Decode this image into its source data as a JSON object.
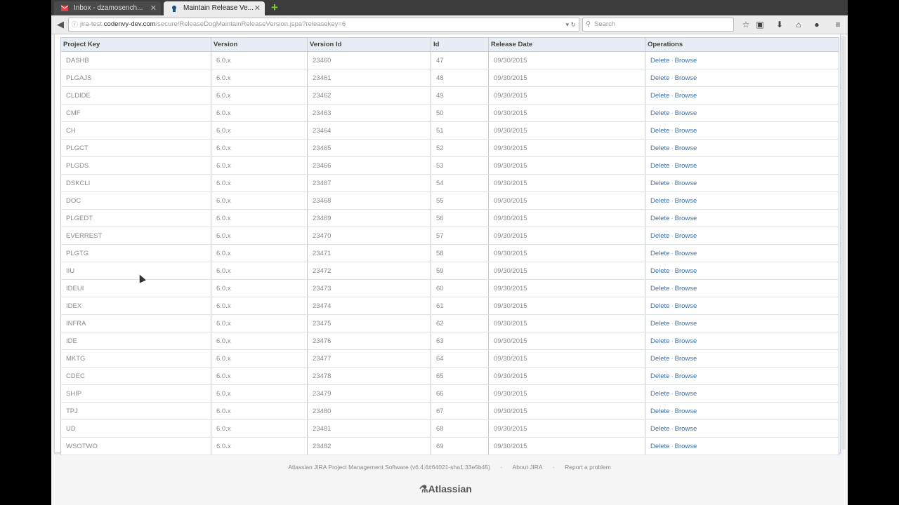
{
  "tabs": [
    {
      "label": "Inbox - dzamosench...",
      "active": false
    },
    {
      "label": "Maintain Release Ve...",
      "active": true
    }
  ],
  "url": {
    "prefix": "jira-test.",
    "domain": "codenvy-dev.com",
    "path": "/secure/ReleaseDogMaintainReleaseVersion.jspa?releasekey=6"
  },
  "search_placeholder": "Search",
  "columns": [
    "Project Key",
    "Version",
    "Version Id",
    "Id",
    "Release Date",
    "Operations"
  ],
  "rows": [
    {
      "key": "DASHB",
      "version": "6.0.x",
      "version_id": "23460",
      "id": "47",
      "date": "09/30/2015"
    },
    {
      "key": "PLGAJS",
      "version": "6.0.x",
      "version_id": "23461",
      "id": "48",
      "date": "09/30/2015"
    },
    {
      "key": "CLDIDE",
      "version": "6.0.x",
      "version_id": "23462",
      "id": "49",
      "date": "09/30/2015"
    },
    {
      "key": "CMF",
      "version": "6.0.x",
      "version_id": "23463",
      "id": "50",
      "date": "09/30/2015"
    },
    {
      "key": "CH",
      "version": "6.0.x",
      "version_id": "23464",
      "id": "51",
      "date": "09/30/2015"
    },
    {
      "key": "PLGCT",
      "version": "6.0.x",
      "version_id": "23465",
      "id": "52",
      "date": "09/30/2015"
    },
    {
      "key": "PLGDS",
      "version": "6.0.x",
      "version_id": "23466",
      "id": "53",
      "date": "09/30/2015"
    },
    {
      "key": "DSKCLI",
      "version": "6.0.x",
      "version_id": "23467",
      "id": "54",
      "date": "09/30/2015"
    },
    {
      "key": "DOC",
      "version": "6.0.x",
      "version_id": "23468",
      "id": "55",
      "date": "09/30/2015"
    },
    {
      "key": "PLGEDT",
      "version": "6.0.x",
      "version_id": "23469",
      "id": "56",
      "date": "09/30/2015"
    },
    {
      "key": "EVERREST",
      "version": "6.0.x",
      "version_id": "23470",
      "id": "57",
      "date": "09/30/2015"
    },
    {
      "key": "PLGTG",
      "version": "6.0.x",
      "version_id": "23471",
      "id": "58",
      "date": "09/30/2015"
    },
    {
      "key": "IIU",
      "version": "6.0.x",
      "version_id": "23472",
      "id": "59",
      "date": "09/30/2015"
    },
    {
      "key": "IDEUI",
      "version": "6.0.x",
      "version_id": "23473",
      "id": "60",
      "date": "09/30/2015"
    },
    {
      "key": "IDEX",
      "version": "6.0.x",
      "version_id": "23474",
      "id": "61",
      "date": "09/30/2015"
    },
    {
      "key": "INFRA",
      "version": "6.0.x",
      "version_id": "23475",
      "id": "62",
      "date": "09/30/2015"
    },
    {
      "key": "IDE",
      "version": "6.0.x",
      "version_id": "23476",
      "id": "63",
      "date": "09/30/2015"
    },
    {
      "key": "MKTG",
      "version": "6.0.x",
      "version_id": "23477",
      "id": "64",
      "date": "09/30/2015"
    },
    {
      "key": "CDEC",
      "version": "6.0.x",
      "version_id": "23478",
      "id": "65",
      "date": "09/30/2015"
    },
    {
      "key": "SHIP",
      "version": "6.0.x",
      "version_id": "23479",
      "id": "66",
      "date": "09/30/2015"
    },
    {
      "key": "TPJ",
      "version": "6.0.x",
      "version_id": "23480",
      "id": "67",
      "date": "09/30/2015"
    },
    {
      "key": "UD",
      "version": "6.0.x",
      "version_id": "23481",
      "id": "68",
      "date": "09/30/2015"
    },
    {
      "key": "WSOTWO",
      "version": "6.0.x",
      "version_id": "23482",
      "id": "69",
      "date": "09/30/2015"
    }
  ],
  "operations": {
    "delete": "Delete",
    "separator": "·",
    "browse": "Browse"
  },
  "footer": {
    "software": "Atlassian JIRA Project Management Software (v6.4.6#64021-sha1:33e5b45)",
    "about": "About JIRA",
    "report": "Report a problem",
    "logo": "Atlassian"
  },
  "colors": {
    "link": "#3b73af",
    "header_bg": "#e6edf4"
  }
}
